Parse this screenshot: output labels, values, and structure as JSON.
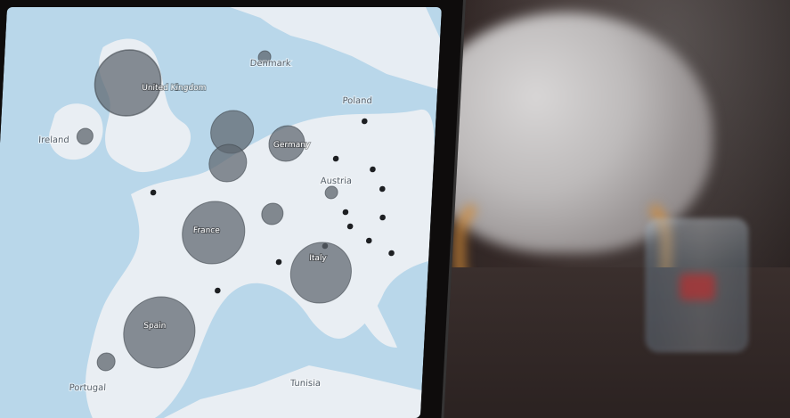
{
  "map": {
    "labels": {
      "ireland": "Ireland",
      "united_kingdom": "United Kingdom",
      "denmark": "Denmark",
      "germany": "Germany",
      "poland": "Poland",
      "austria": "Austria",
      "france": "France",
      "italy": "Italy",
      "spain": "Spain",
      "portugal": "Portugal",
      "tunisia": "Tunisia"
    },
    "colors": {
      "sea": "#b9d7ea",
      "land": "#e9eef3",
      "bubble": "#5d656e"
    }
  }
}
